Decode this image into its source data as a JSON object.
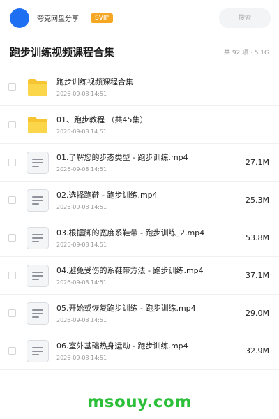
{
  "header": {
    "app_name": "夸克网盘分享",
    "badge": "SVIP",
    "search_placeholder": "搜索"
  },
  "title_bar": {
    "title": "跑步训练视频课程合集",
    "summary": "共 92 项 · 5.1G"
  },
  "colors": {
    "accent": "#1f6ff2",
    "badge": "#f5a623",
    "folder": "#f7c531",
    "watermark": "#2cbf3a"
  },
  "files": [
    {
      "type": "folder",
      "name": "跑步训练视频课程合集",
      "date": "2026-09-08 14:51",
      "size": ""
    },
    {
      "type": "folder",
      "name": "01、跑步教程 （共45集）",
      "date": "2026-09-08 14:51",
      "size": ""
    },
    {
      "type": "file",
      "name": "01.了解您的步态类型 - 跑步训练.mp4",
      "date": "2026-09-08 14:51",
      "size": "27.1M"
    },
    {
      "type": "file",
      "name": "02.选择跑鞋 - 跑步训练.mp4",
      "date": "2026-09-08 14:51",
      "size": "25.3M"
    },
    {
      "type": "file",
      "name": "03.根据脚的宽度系鞋带 - 跑步训练_2.mp4",
      "date": "2026-09-08 14:51",
      "size": "53.8M"
    },
    {
      "type": "file",
      "name": "04.避免受伤的系鞋带方法 - 跑步训练.mp4",
      "date": "2026-09-08 14:51",
      "size": "37.1M"
    },
    {
      "type": "file",
      "name": "05.开始或恢复跑步训练 - 跑步训练.mp4",
      "date": "2026-09-08 14:51",
      "size": "29.0M"
    },
    {
      "type": "file",
      "name": "06.室外基础热身运动 - 跑步训练.mp4",
      "date": "2026-09-08 14:51",
      "size": "32.9M"
    }
  ],
  "watermark": "msouy.com"
}
